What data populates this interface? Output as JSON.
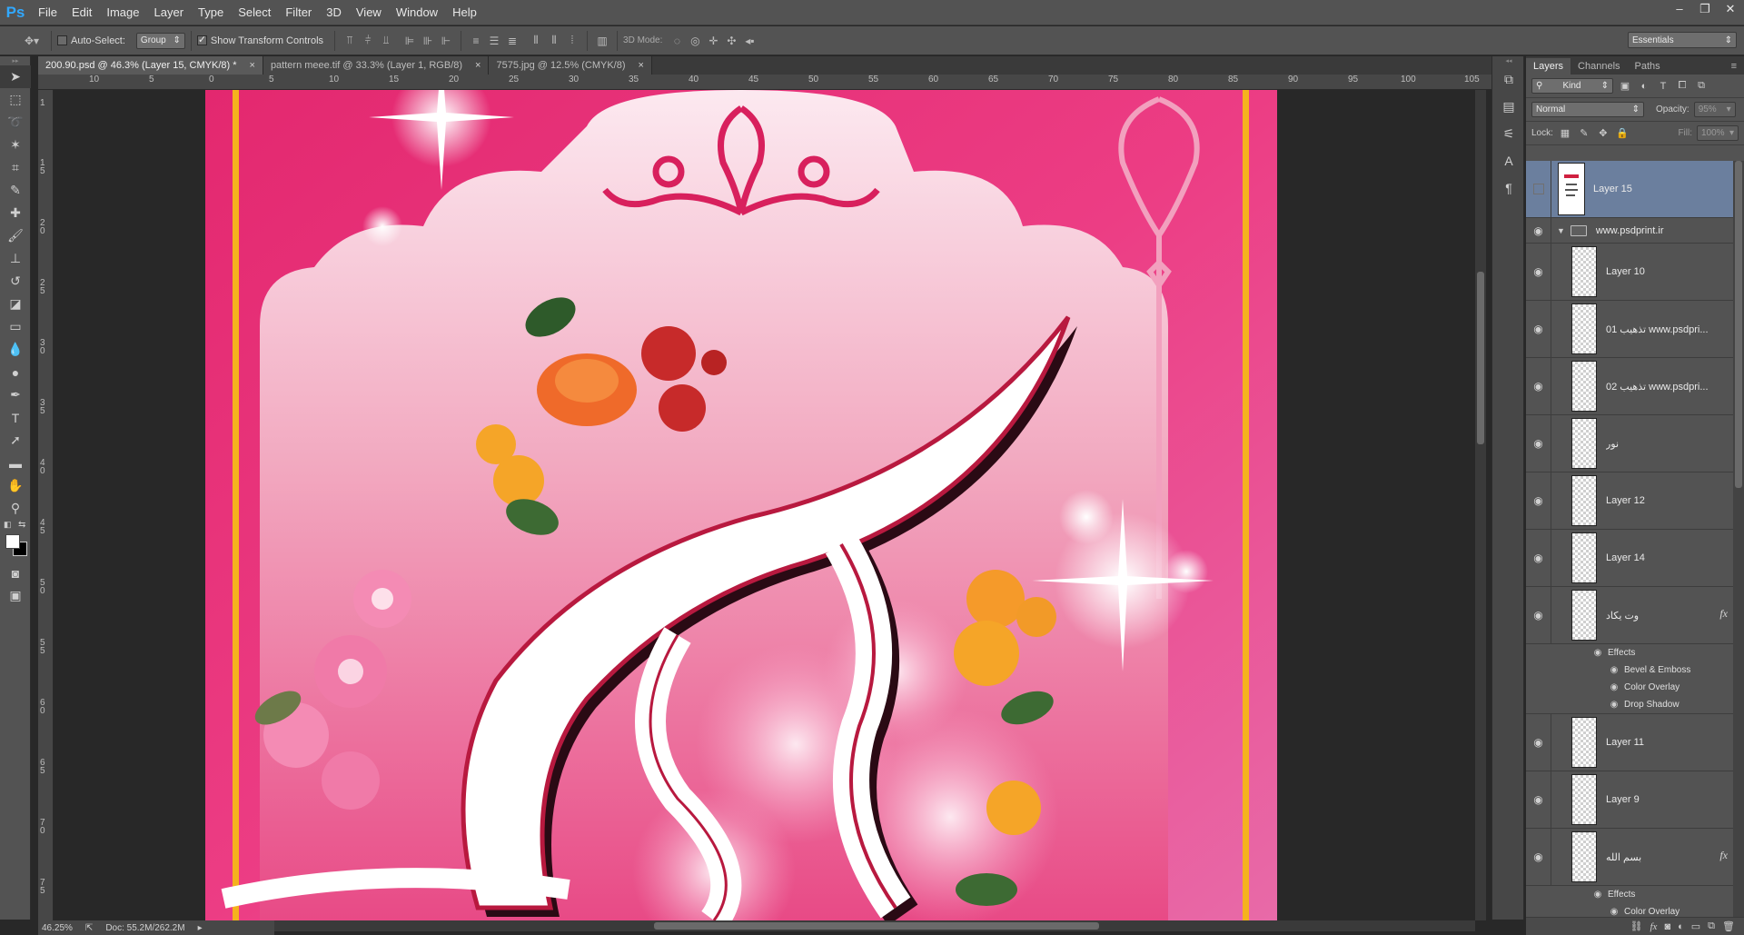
{
  "app": {
    "logo": "Ps"
  },
  "menu": [
    "File",
    "Edit",
    "Image",
    "Layer",
    "Type",
    "Select",
    "Filter",
    "3D",
    "View",
    "Window",
    "Help"
  ],
  "window_controls": [
    "minimize",
    "restore",
    "close"
  ],
  "options": {
    "auto_select_label": "Auto-Select:",
    "auto_select_checked": false,
    "auto_select_target": "Group",
    "transform_label": "Show Transform Controls",
    "transform_checked": true,
    "mode3d_label": "3D Mode:",
    "workspace": "Essentials"
  },
  "tabs": [
    {
      "title": "200.90.psd @ 46.3% (Layer 15, CMYK/8) *",
      "active": true
    },
    {
      "title": "pattern meee.tif @ 33.3% (Layer 1, RGB/8)",
      "active": false
    },
    {
      "title": "7575.jpg @ 12.5% (CMYK/8)",
      "active": false
    }
  ],
  "ruler_top": [
    "10",
    "5",
    "0",
    "5",
    "10",
    "15",
    "20",
    "25",
    "30",
    "35",
    "40",
    "45",
    "50",
    "55",
    "60",
    "65",
    "70",
    "75",
    "80",
    "85",
    "90",
    "95",
    "100",
    "105"
  ],
  "ruler_left": [
    "1",
    "1 5",
    "2 0",
    "2 5",
    "3 0",
    "3 5",
    "4 0",
    "4 5",
    "5 0",
    "5 5",
    "6 0",
    "6 5",
    "7 0",
    "7 5"
  ],
  "status": {
    "zoom": "46.25%",
    "doc": "Doc: 55.2M/262.2M"
  },
  "panel": {
    "tabs": [
      "Layers",
      "Channels",
      "Paths"
    ],
    "filter_kind": "Kind",
    "blend_mode": "Normal",
    "opacity_label": "Opacity:",
    "opacity_value": "95%",
    "lock_label": "Lock:",
    "fill_label": "Fill:",
    "fill_value": "100%"
  },
  "layers": {
    "layer15": "Layer 15",
    "group": "www.psdprint.ir",
    "layer10": "Layer 10",
    "tazhib01": "01 تذهيب  www.psdpri...",
    "tazhib02": "02 تذهيب  www.psdpri...",
    "noor": "نور",
    "layer12": "Layer 12",
    "layer14": "Layer 14",
    "vanyakad": "وت يكاد",
    "effects1": "Effects",
    "bevel": "Bevel & Emboss",
    "coloroverlay1": "Color Overlay",
    "dropshadow": "Drop Shadow",
    "layer11": "Layer 11",
    "layer9": "Layer 9",
    "bismillah": "بسم الله",
    "effects2": "Effects",
    "coloroverlay2": "Color Overlay",
    "fx_symbol": "fx"
  },
  "colors": {
    "accent": "#31a8ff",
    "selection": "#6b7f9e",
    "artwork_pink": "#e8337a",
    "artwork_gold": "#f5b21e",
    "arch": "#fbe4ec"
  }
}
